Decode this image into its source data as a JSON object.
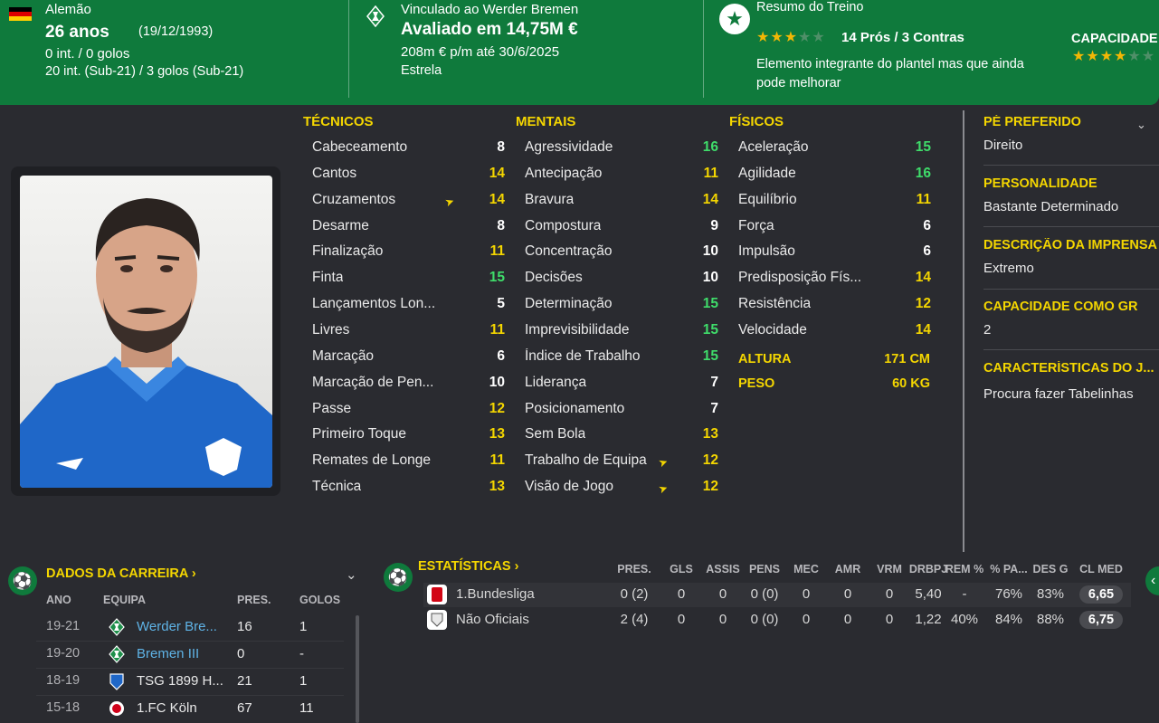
{
  "header": {
    "nationality": "Alemão",
    "age": "26 anos",
    "birth_date": "(19/12/1993)",
    "intl_caps": "0 int. / 0 golos",
    "u21_caps": "20 int. (Sub-21) / 3 golos (Sub-21)",
    "contract_club": "Vinculado ao Werder Bremen",
    "value": "Avaliado em 14,75M €",
    "wage": "208m € p/m até 30/6/2025",
    "squad_status": "Estrela",
    "training_summary_title": "Resumo do Treino",
    "training_rating_stars": 3,
    "training_pros_cons": "14 Prós / 3 Contras",
    "training_desc_line1": "Elemento integrante do plantel mas que ainda",
    "training_desc_line2": "pode melhorar",
    "ability_label": "CAPACIDADE",
    "ability_stars": 3.5
  },
  "attributes": {
    "technical_title": "TÉCNICOS",
    "mental_title": "MENTAIS",
    "physical_title": "FÍSICOS",
    "technical": [
      {
        "name": "Cabeceamento",
        "value": "8"
      },
      {
        "name": "Cantos",
        "value": "14"
      },
      {
        "name": "Cruzamentos",
        "value": "14",
        "arrow": true
      },
      {
        "name": "Desarme",
        "value": "8"
      },
      {
        "name": "Finalização",
        "value": "11"
      },
      {
        "name": "Finta",
        "value": "15"
      },
      {
        "name": "Lançamentos Lon...",
        "value": "5"
      },
      {
        "name": "Livres",
        "value": "11"
      },
      {
        "name": "Marcação",
        "value": "6"
      },
      {
        "name": "Marcação de Pen...",
        "value": "10"
      },
      {
        "name": "Passe",
        "value": "12"
      },
      {
        "name": "Primeiro Toque",
        "value": "13"
      },
      {
        "name": "Remates de Longe",
        "value": "11"
      },
      {
        "name": "Técnica",
        "value": "13"
      }
    ],
    "mental": [
      {
        "name": "Agressividade",
        "value": "16"
      },
      {
        "name": "Antecipação",
        "value": "11"
      },
      {
        "name": "Bravura",
        "value": "14"
      },
      {
        "name": "Compostura",
        "value": "9"
      },
      {
        "name": "Concentração",
        "value": "10"
      },
      {
        "name": "Decisões",
        "value": "10"
      },
      {
        "name": "Determinação",
        "value": "15"
      },
      {
        "name": "Imprevisibilidade",
        "value": "15"
      },
      {
        "name": "Índice de Trabalho",
        "value": "15"
      },
      {
        "name": "Liderança",
        "value": "7"
      },
      {
        "name": "Posicionamento",
        "value": "7"
      },
      {
        "name": "Sem Bola",
        "value": "13"
      },
      {
        "name": "Trabalho de Equipa",
        "value": "12",
        "arrow": true
      },
      {
        "name": "Visão de Jogo",
        "value": "12",
        "arrow": true
      }
    ],
    "physical": [
      {
        "name": "Aceleração",
        "value": "15"
      },
      {
        "name": "Agilidade",
        "value": "16"
      },
      {
        "name": "Equilíbrio",
        "value": "11"
      },
      {
        "name": "Força",
        "value": "6"
      },
      {
        "name": "Impulsão",
        "value": "6"
      },
      {
        "name": "Predisposição Fís...",
        "value": "14"
      },
      {
        "name": "Resistência",
        "value": "12"
      },
      {
        "name": "Velocidade",
        "value": "14"
      }
    ],
    "height_label": "ALTURA",
    "height_value": "171 CM",
    "weight_label": "PESO",
    "weight_value": "60 KG"
  },
  "side": {
    "preferred_foot_label": "PÉ PREFERIDO",
    "preferred_foot": "Direito",
    "personality_label": "PERSONALIDADE",
    "personality": "Bastante Determinado",
    "media_label": "DESCRIÇÃO DA IMPRENSA",
    "media": "Extremo",
    "gk_label": "CAPACIDADE COMO GR",
    "gk": "2",
    "traits_label": "CARACTERÍSTICAS DO J...",
    "traits": "Procura fazer Tabelinhas"
  },
  "career": {
    "title": "DADOS DA CARREIRA",
    "headers": [
      "ANO",
      "EQUIPA",
      "PRES.",
      "GOLOS"
    ],
    "rows": [
      {
        "year": "19-21",
        "team": "Werder Bre...",
        "apps": "16",
        "goals": "1",
        "link": true,
        "badge": "werder"
      },
      {
        "year": "19-20",
        "team": "Bremen III",
        "apps": "0",
        "goals": "-",
        "link": true,
        "badge": "werder"
      },
      {
        "year": "18-19",
        "team": "TSG 1899 H...",
        "apps": "21",
        "goals": "1",
        "link": false,
        "badge": "hoffenheim"
      },
      {
        "year": "15-18",
        "team": "1.FC Köln",
        "apps": "67",
        "goals": "11",
        "link": false,
        "badge": "koln"
      }
    ]
  },
  "stats": {
    "title": "ESTATÍSTICAS",
    "headers": [
      "PRES.",
      "GLS",
      "ASSIS",
      "PENS",
      "MEC",
      "AMR",
      "VRM",
      "DRBPJ",
      "REM %",
      "% PA...",
      "DES G",
      "CL MED"
    ],
    "rows": [
      {
        "competition": "1.Bundesliga",
        "values": [
          "0 (2)",
          "0",
          "0",
          "0 (0)",
          "0",
          "0",
          "0",
          "5,40",
          "-",
          "76%",
          "83%"
        ],
        "rating": "6,65"
      },
      {
        "competition": "Não Oficiais",
        "values": [
          "2 (4)",
          "0",
          "0",
          "0 (0)",
          "0",
          "0",
          "0",
          "1,22",
          "40%",
          "84%",
          "88%"
        ],
        "rating": "6,75"
      }
    ]
  },
  "colors": {
    "accent_green": "#0f7a3c",
    "attr_yellow": "#f4d600",
    "attr_green": "#3fdc6a",
    "link_blue": "#5fb3e6"
  }
}
